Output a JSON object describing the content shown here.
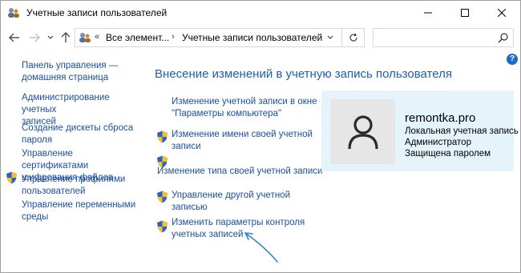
{
  "window": {
    "title": "Учетные записи пользователей"
  },
  "navigation": {
    "breadcrumb_sep": "«",
    "breadcrumb_1": "Все элемент...",
    "breadcrumb_arrow": "›",
    "breadcrumb_2": "Учетные записи пользователей",
    "search_placeholder": ""
  },
  "help_label": "?",
  "sidebar": {
    "items": [
      {
        "label_line1": "Панель управления —",
        "label_line2": "домашняя страница"
      },
      {
        "label_line1": "Администрирование учетных",
        "label_line2": "записей"
      },
      {
        "label_line1": "Создание дискеты сброса",
        "label_line2": "пароля"
      },
      {
        "label_line1": "Управление сертификатами",
        "label_line2": "шифрования файлов"
      },
      {
        "label_line1": "Управление профилями",
        "label_line2": "пользователей"
      },
      {
        "label_line1": "Управление переменными",
        "label_line2": "среды"
      }
    ]
  },
  "main": {
    "title": "Внесение изменений в учетную запись пользователя",
    "tasks": [
      {
        "line1": "Изменение учетной записи в окне",
        "line2": "\"Параметры компьютера\""
      },
      {
        "line1": "Изменение имени своей учетной",
        "line2": "записи"
      },
      {
        "line1": "Изменение типа своей учетной записи",
        "line2": ""
      },
      {
        "line1": "Управление другой учетной",
        "line2": "записью"
      },
      {
        "line1": "Изменить параметры контроля",
        "line2": "учетных записей"
      }
    ]
  },
  "user": {
    "name": "remontka.pro",
    "account_type": "Локальная учетная запись",
    "role": "Администратор",
    "password_status": "Защищена паролем"
  },
  "colors": {
    "link": "#1a4f9c",
    "heading": "#1e5fa8",
    "card_bg": "#e5f3fb",
    "annotation_arrow": "#2b86c5"
  }
}
